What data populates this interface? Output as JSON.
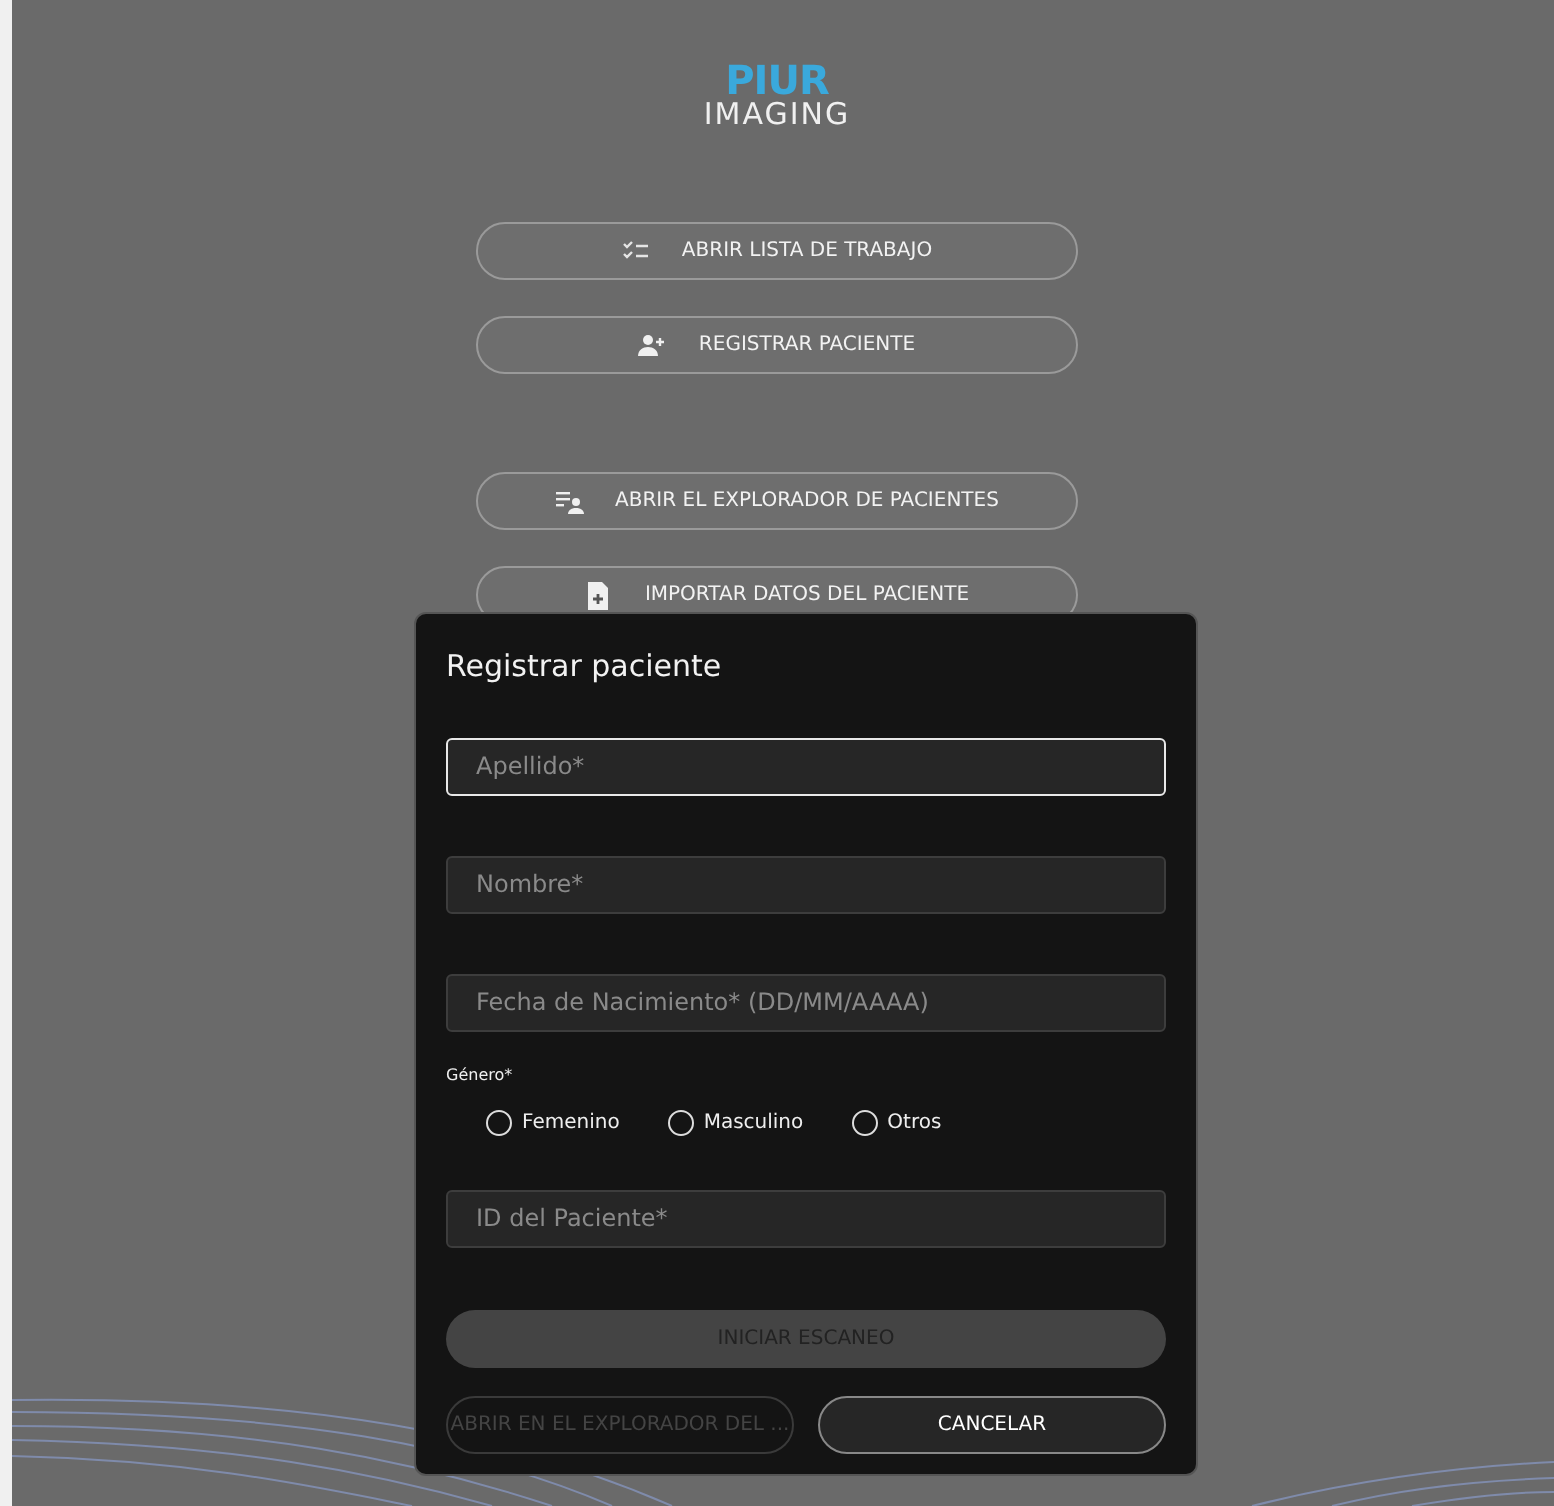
{
  "logo": {
    "line_1": "PIUR",
    "line_2": "IMAGING"
  },
  "menu": [
    {
      "label": "ABRIR LISTA DE TRABAJO",
      "kind": "checklist"
    },
    {
      "label": "REGISTRAR PACIENTE",
      "kind": "add-user"
    },
    {
      "label": "ABRIR EL EXPLORADOR DE PACIENTES",
      "kind": "user-list"
    },
    {
      "label": "IMPORTAR DATOS DEL PACIENTE",
      "kind": "file"
    }
  ],
  "dialog": {
    "title": "Registrar paciente",
    "fields_top": [
      {
        "placeholder": "Apellido*",
        "focused": true
      },
      {
        "placeholder": "Nombre*",
        "focused": false
      },
      {
        "placeholder": "Fecha de Nacimiento* (DD/MM/AAAA)",
        "focused": false
      }
    ],
    "gender": {
      "label": "Género*",
      "options": [
        {
          "label": "Femenino",
          "selected": false
        },
        {
          "label": "Masculino",
          "selected": false
        },
        {
          "label": "Otros",
          "selected": false
        }
      ]
    },
    "fields_bottom": [
      {
        "placeholder": "ID del Paciente*",
        "focused": false
      }
    ],
    "start_button": {
      "label": "INICIAR ESCANEO",
      "disabled": true
    },
    "buttons": [
      {
        "label": "ABRIR EN EL EXPLORADOR DEL ...",
        "disabled": true
      },
      {
        "label": "CANCELAR",
        "disabled": false
      }
    ]
  }
}
